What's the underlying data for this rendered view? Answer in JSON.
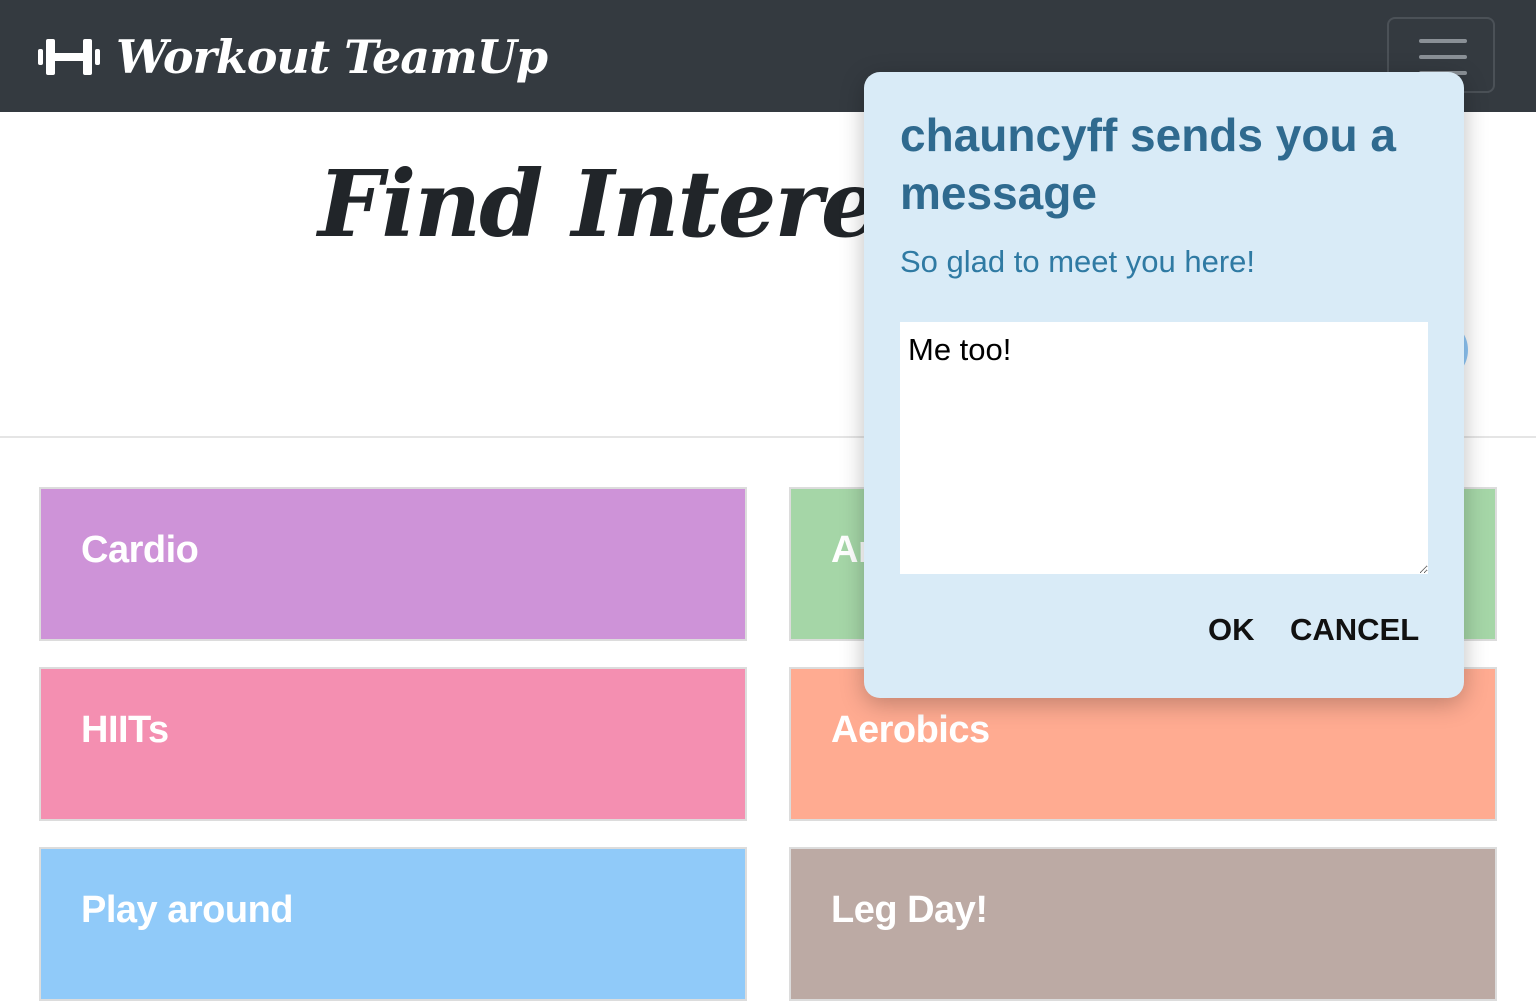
{
  "navbar": {
    "brand_name": "Workout TeamUp",
    "brand_icon": "dumbbell-icon",
    "menu_icon": "hamburger-icon",
    "background": "#343a40"
  },
  "header": {
    "title": "Find Intereste"
  },
  "categories": [
    {
      "label": "Cardio",
      "color": "#ce93d8"
    },
    {
      "label": "Ar",
      "color": "#a5d6a7"
    },
    {
      "label": "HIITs",
      "color": "#f48fb1"
    },
    {
      "label": "Aerobics",
      "color": "#ffab91"
    },
    {
      "label": "Play around",
      "color": "#90caf9"
    },
    {
      "label": "Leg Day!",
      "color": "#bcaaa4"
    }
  ],
  "modal": {
    "title": "chauncyff sends you a message",
    "body": "So glad to meet you here!",
    "reply_value": "Me too!",
    "ok_label": "OK",
    "cancel_label": "CANCEL",
    "background": "#d9ebf7",
    "title_color": "#2f6a8f"
  }
}
